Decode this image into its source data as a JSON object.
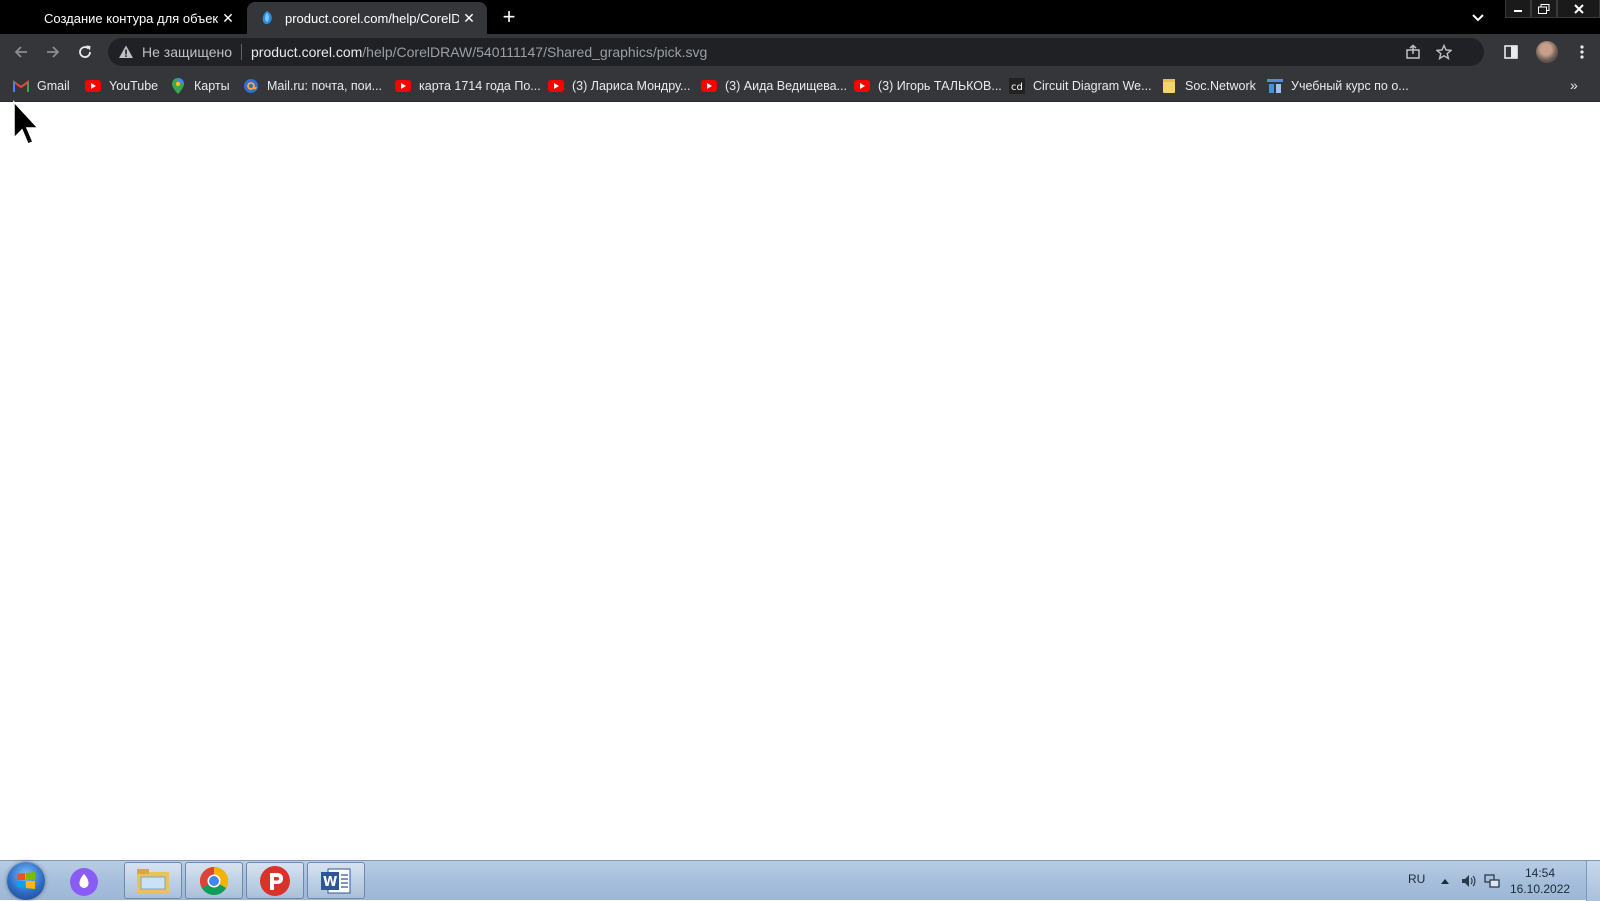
{
  "tabs": [
    {
      "title": "Создание контура для объектов",
      "active": false
    },
    {
      "title": "product.corel.com/help/CorelDRAW",
      "active": true
    }
  ],
  "address_bar": {
    "security_label": "Не защищено",
    "url_host": "product.corel.com",
    "url_path": "/help/CorelDRAW/540111147/Shared_graphics/pick.svg"
  },
  "bookmarks": [
    {
      "label": "Gmail",
      "icon": "gmail-icon"
    },
    {
      "label": "YouTube",
      "icon": "youtube-icon"
    },
    {
      "label": "Карты",
      "icon": "maps-icon"
    },
    {
      "label": "Mail.ru: почта, пои...",
      "icon": "mailru-icon"
    },
    {
      "label": "карта 1714 года По...",
      "icon": "youtube-icon"
    },
    {
      "label": "(3) Лариса Мондру...",
      "icon": "youtube-icon"
    },
    {
      "label": "(3) Аида Ведищева...",
      "icon": "youtube-icon"
    },
    {
      "label": "(3) Игорь ТАЛЬКОВ...",
      "icon": "youtube-icon"
    },
    {
      "label": "Circuit Diagram We...",
      "icon": "circuit-diagram-icon"
    },
    {
      "label": "Soc.Network",
      "icon": "folder-icon"
    },
    {
      "label": "Учебный курс по о...",
      "icon": "course-icon"
    }
  ],
  "bookmarks_overflow": "»",
  "taskbar": {
    "apps": [
      "alice-assistant",
      "file-explorer",
      "chrome",
      "ppt-like-p-app",
      "word"
    ],
    "language": "RU",
    "time": "14:54",
    "date": "16.10.2022"
  },
  "colors": {
    "tabstrip_bg": "#000000",
    "toolbar_bg": "#35363a",
    "omnibox_bg": "#202124",
    "page_bg": "#ffffff",
    "taskbar_bg": "#a6bfdb"
  }
}
